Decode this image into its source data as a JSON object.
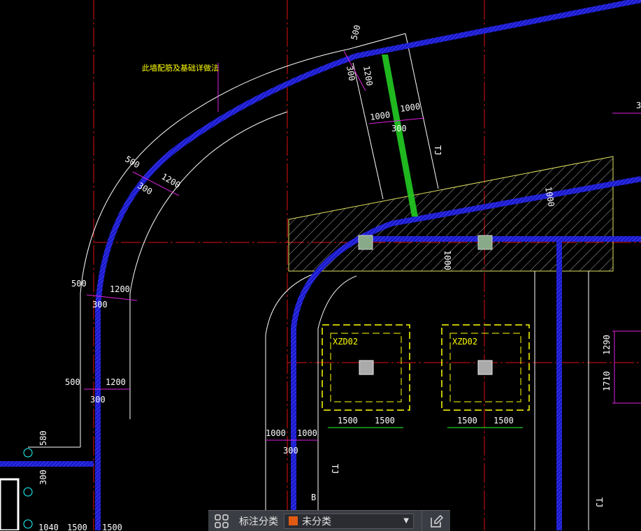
{
  "drawing": {
    "note": "此墙配筋及基础详做法",
    "foundations": [
      {
        "label": "XZD02",
        "dims": [
          "1500",
          "1500"
        ]
      },
      {
        "label": "XZD02",
        "dims": [
          "1500",
          "1500"
        ]
      }
    ],
    "dims": {
      "d500a": "500",
      "d300a": "300",
      "d1200a": "1200",
      "d1000a": "1000",
      "d1000b": "1000",
      "d300b": "300",
      "d500b": "500",
      "d300c": "300",
      "d1200b": "1200",
      "d500c": "500",
      "d1200c": "1200",
      "d300d": "300",
      "d500d": "500",
      "d1200d": "1200",
      "d300e": "300",
      "d580": "580",
      "d300f": "300",
      "d1000c": "1000",
      "d1000d": "1000",
      "d300g": "300",
      "d1000e": "1000",
      "d1000f": "1000",
      "d1290": "1290",
      "d1710": "1710",
      "d3": "3",
      "d1040": "1040",
      "d1500a": "1500",
      "d1500b": "1500"
    },
    "marks": {
      "tj1": "TJ",
      "tj2": "TJ",
      "tj3": "TJ",
      "b": "B"
    }
  },
  "toolbar": {
    "label": "标注分类",
    "selected": "未分类",
    "swatch_color": "#e05a12",
    "icons": [
      "grid-icon",
      "chevron-down-icon",
      "edit-icon"
    ]
  }
}
